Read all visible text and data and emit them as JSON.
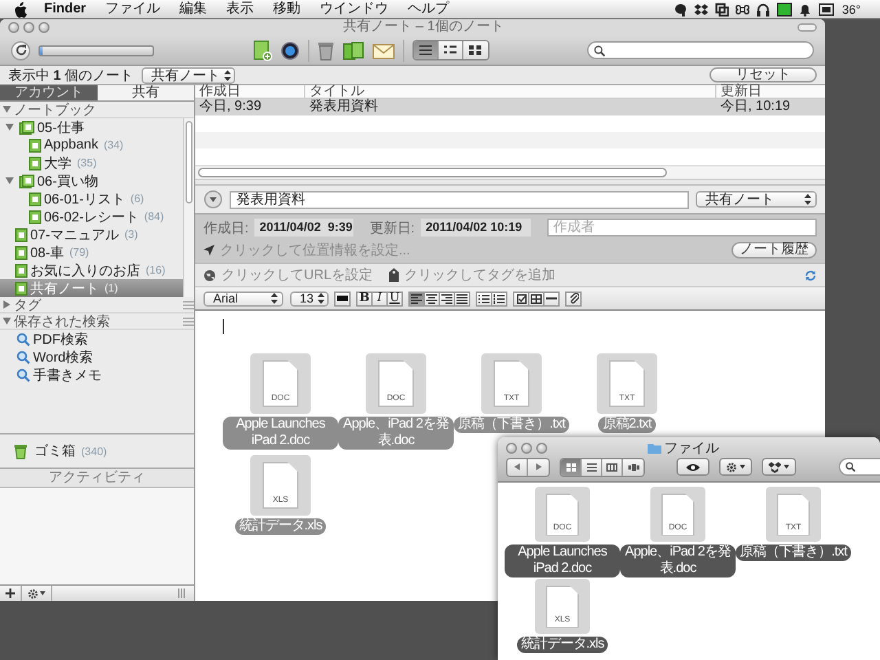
{
  "menu_bar": {
    "items": [
      "Finder",
      "ファイル",
      "編集",
      "表示",
      "移動",
      "ウインドウ",
      "ヘルプ"
    ],
    "temperature": "36°"
  },
  "window": {
    "title": "共有ノート – 1個のノート"
  },
  "toolbar": {
    "progress": {
      "level": 0.03
    },
    "view_modes": [
      {
        "selected": true
      },
      {
        "selected": false
      },
      {
        "selected": false
      }
    ]
  },
  "filter_bar": {
    "status": "表示中 **1** 個のノート",
    "scope": "共有ノート",
    "reset": "リセット"
  },
  "sidebar": {
    "tabs": [
      {
        "label": "アカウント",
        "selected": true
      },
      {
        "label": "共有",
        "selected": false
      }
    ],
    "sections": [
      {
        "kind": "notebooks",
        "label": "ノートブック",
        "expanded": true,
        "items": [
          {
            "label": "05-仕事",
            "selected": false,
            "expanded": true,
            "children": [
              {
                "label": "Appbank",
                "count": "(34)",
                "selected": false
              },
              {
                "label": "大学",
                "count": "(35)",
                "selected": false
              }
            ]
          },
          {
            "label": "06-買い物",
            "selected": false,
            "expanded": true,
            "children": [
              {
                "label": "06-01-リスト",
                "count": "(6)",
                "selected": false
              },
              {
                "label": "06-02-レシート",
                "count": "(84)",
                "selected": false
              }
            ]
          },
          {
            "label": "07-マニュアル",
            "count": "(3)",
            "selected": false
          },
          {
            "label": "08-車",
            "count": "(79)",
            "selected": false
          },
          {
            "label": "お気に入りのお店",
            "count": "(16)",
            "selected": false
          },
          {
            "label": "共有ノート",
            "count": "(1)",
            "selected": true
          }
        ]
      },
      {
        "kind": "tags",
        "label": "タグ",
        "expanded": false
      },
      {
        "kind": "searches",
        "label": "保存された検索",
        "expanded": true,
        "items": [
          {
            "label": "PDF検索",
            "selected": false
          },
          {
            "label": "Word検索",
            "selected": false
          },
          {
            "label": "手書きメモ",
            "selected": false
          }
        ]
      }
    ],
    "trash": {
      "label": "ゴミ箱",
      "count": "(340)"
    },
    "activity": "アクティビティ"
  },
  "note_list": {
    "columns": [
      "作成日",
      "タイトル",
      "更新日"
    ],
    "rows": [
      {
        "cells": [
          "今日, 9:39",
          "発表用資料",
          "今日, 10:19"
        ],
        "selected": true
      }
    ]
  },
  "note": {
    "title": "発表用資料",
    "notebook": "共有ノート",
    "created_label": "作成日:",
    "created": "2011/04/02  9:39",
    "updated_label": "更新日:",
    "updated": "2011/04/02 10:19",
    "author_placeholder": "作成者",
    "location": "クリックして位置情報を設定...",
    "history": "ノート履歴",
    "url": "クリックしてURLを設定",
    "tags": "クリックしてタグを追加"
  },
  "format_bar": {
    "font": "Arial",
    "size": "13",
    "styles": [
      {
        "label": "B",
        "kind": "bold"
      },
      {
        "label": "I",
        "kind": "italic"
      },
      {
        "label": "U",
        "kind": "underline"
      }
    ],
    "alignment": [
      {
        "selected": true
      },
      {
        "selected": false
      },
      {
        "selected": false
      },
      {
        "selected": false
      }
    ]
  },
  "attachments": [
    {
      "name": "Apple Launches iPad 2.doc",
      "type": "DOC"
    },
    {
      "name": "Apple、iPad 2を発表.doc",
      "type": "DOC"
    },
    {
      "name": "原稿（下書き）.txt",
      "type": "TXT"
    },
    {
      "name": "原稿2.txt",
      "type": "TXT"
    },
    {
      "name": "統計データ.xls",
      "type": "XLS"
    }
  ],
  "finder": {
    "title": "ファイル",
    "view_modes": [
      {
        "selected": true
      },
      {
        "selected": false
      },
      {
        "selected": false
      },
      {
        "selected": false
      }
    ],
    "files": [
      {
        "name": "Apple Launches iPad 2.doc",
        "type": "DOC"
      },
      {
        "name": "Apple、iPad 2を発表.doc",
        "type": "DOC"
      },
      {
        "name": "原稿（下書き）.txt",
        "type": "TXT"
      },
      {
        "name": "統計データ.xls",
        "type": "XLS"
      }
    ]
  }
}
